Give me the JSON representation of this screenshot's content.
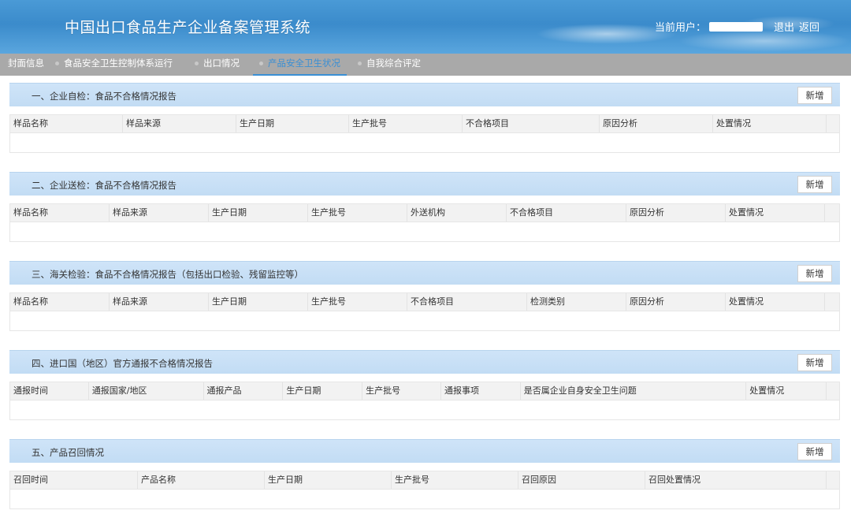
{
  "header": {
    "title": "中国出口食品生产企业备案管理系统",
    "current_user_label": "当前用户：",
    "logout": "退出",
    "back": "返回"
  },
  "nav": {
    "tabs": [
      {
        "label": "封面信息",
        "active": false
      },
      {
        "label": "食品安全卫生控制体系运行",
        "active": false
      },
      {
        "label": "出口情况",
        "active": false
      },
      {
        "label": "产品安全卫生状况",
        "active": true
      },
      {
        "label": "自我综合评定",
        "active": false
      }
    ]
  },
  "sections": [
    {
      "title": "一、企业自检：食品不合格情况报告",
      "add_label": "新增",
      "columns": [
        "样品名称",
        "样品来源",
        "生产日期",
        "生产批号",
        "不合格项目",
        "原因分析",
        "处置情况"
      ]
    },
    {
      "title": "二、企业送检：食品不合格情况报告",
      "add_label": "新增",
      "columns": [
        "样品名称",
        "样品来源",
        "生产日期",
        "生产批号",
        "外送机构",
        "不合格项目",
        "原因分析",
        "处置情况"
      ]
    },
    {
      "title": "三、海关检验：食品不合格情况报告（包括出口检验、残留监控等）",
      "add_label": "新增",
      "columns": [
        "样品名称",
        "样品来源",
        "生产日期",
        "生产批号",
        "不合格项目",
        "检测类别",
        "原因分析",
        "处置情况"
      ]
    },
    {
      "title": "四、进口国（地区）官方通报不合格情况报告",
      "add_label": "新增",
      "columns": [
        "通报时间",
        "通报国家/地区",
        "通报产品",
        "生产日期",
        "生产批号",
        "通报事项",
        "是否属企业自身安全卫生问题",
        "处置情况"
      ]
    },
    {
      "title": "五、产品召回情况",
      "add_label": "新增",
      "columns": [
        "召回时间",
        "产品名称",
        "生产日期",
        "生产批号",
        "召回原因",
        "召回处置情况"
      ]
    }
  ]
}
